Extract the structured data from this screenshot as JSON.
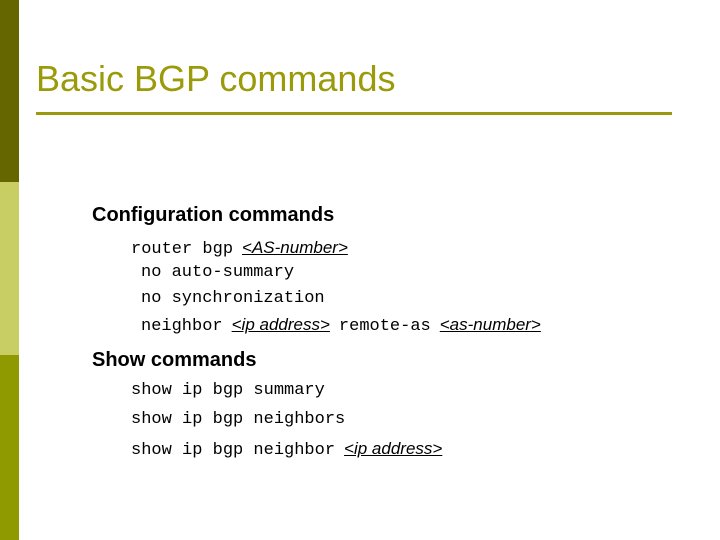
{
  "slide": {
    "title": "Basic BGP commands",
    "accent_color": "#9a9a0a",
    "band_colors": {
      "top": "#666600",
      "middle": "#c8cd64",
      "bottom": "#8f9900"
    },
    "background_color": "#ffffff",
    "text_color": "#000000"
  },
  "sections": {
    "configuration": {
      "heading": "Configuration commands",
      "commands": {
        "router": {
          "text": "router bgp",
          "placeholder": "<AS-number>"
        },
        "auto_summary": {
          "text": "no auto-summary"
        },
        "synchronization": {
          "text": "no synchronization"
        },
        "neighbor": {
          "text_1": "neighbor",
          "placeholder_1": "<ip address>",
          "text_2": "remote-as",
          "placeholder_2": "<as-number>"
        }
      }
    },
    "show": {
      "heading": "Show commands",
      "commands": {
        "summary": {
          "text": "show ip bgp summary"
        },
        "neighbors": {
          "text": "show ip bgp neighbors"
        },
        "neighbor": {
          "text": "show ip bgp neighbor",
          "placeholder": "<ip address>"
        }
      }
    }
  }
}
